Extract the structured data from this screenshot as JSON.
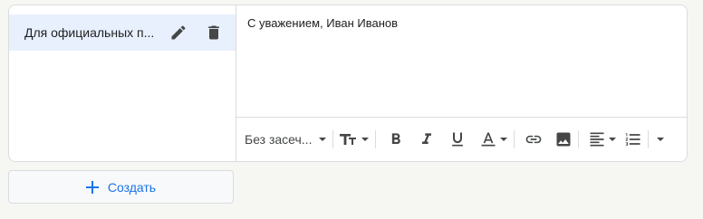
{
  "signatures": [
    {
      "name": "Для официальных п..."
    }
  ],
  "editor": {
    "text": "С уважением, Иван Иванов"
  },
  "toolbar": {
    "font": "Без засеч..."
  },
  "create_button": {
    "label": "Создать"
  },
  "icons": {
    "edit": "pencil-icon",
    "delete": "trash-icon",
    "add": "plus-icon"
  },
  "colors": {
    "selected_bg": "#e8f0fe",
    "accent": "#1a73e8",
    "border": "#dadce0",
    "icon": "#444746"
  }
}
